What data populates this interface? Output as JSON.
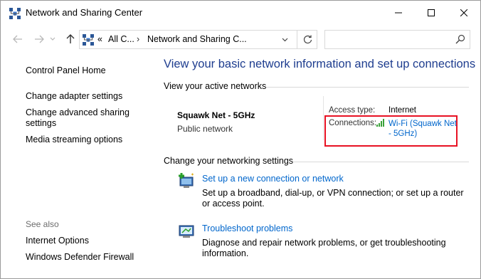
{
  "window": {
    "title": "Network and Sharing Center"
  },
  "address": {
    "overflow": "«",
    "crumbs": [
      "All C...",
      "Network and Sharing C..."
    ],
    "search_placeholder": ""
  },
  "sidebar": {
    "links": [
      "Control Panel Home",
      "Change adapter settings",
      "Change advanced sharing settings",
      "Media streaming options"
    ],
    "see_also_title": "See also",
    "see_also": [
      "Internet Options",
      "Windows Defender Firewall"
    ]
  },
  "main": {
    "title": "View your basic network information and set up connections",
    "active_heading": "View your active networks",
    "network": {
      "name": "Squawk Net - 5GHz",
      "category": "Public network",
      "access_label": "Access type:",
      "access_value": "Internet",
      "connections_label": "Connections:",
      "connection_link": "Wi-Fi (Squawk Net - 5GHz)"
    },
    "change_heading": "Change your networking settings",
    "tasks": [
      {
        "title": "Set up a new connection or network",
        "desc": "Set up a broadband, dial-up, or VPN connection; or set up a router or access point."
      },
      {
        "title": "Troubleshoot problems",
        "desc": "Diagnose and repair network problems, or get troubleshooting information."
      }
    ]
  },
  "icons": [
    "network-center-icon",
    "minimize-icon",
    "maximize-icon",
    "close-icon",
    "back-arrow-icon",
    "forward-arrow-icon",
    "recent-chevron-icon",
    "up-arrow-icon",
    "chevron-down-icon",
    "refresh-icon",
    "search-icon",
    "wifi-signal-icon",
    "new-connection-icon",
    "troubleshoot-icon"
  ],
  "colors": {
    "link": "#0066cc",
    "title": "#1e3d8f",
    "highlight": "#e81123",
    "signal": "#3aa23a"
  }
}
